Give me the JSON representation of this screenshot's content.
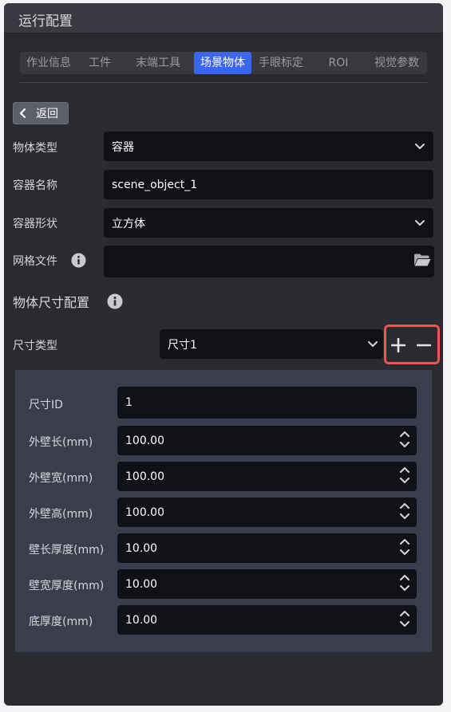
{
  "window": {
    "title": "运行配置"
  },
  "tabs": [
    {
      "label": "作业信息",
      "active": false
    },
    {
      "label": "工件",
      "active": false
    },
    {
      "label": "末端工具",
      "active": false
    },
    {
      "label": "场景物体",
      "active": true
    },
    {
      "label": "手眼标定",
      "active": false
    },
    {
      "label": "ROI",
      "active": false
    },
    {
      "label": "视觉参数",
      "active": false
    }
  ],
  "back_button": {
    "label": "返回"
  },
  "form": {
    "object_type": {
      "label": "物体类型",
      "value": "容器"
    },
    "container_name": {
      "label": "容器名称",
      "value": "scene_object_1"
    },
    "container_shape": {
      "label": "容器形状",
      "value": "立方体"
    },
    "mesh_file": {
      "label": "网格文件",
      "value": ""
    }
  },
  "size_config": {
    "title": "物体尺寸配置",
    "size_type": {
      "label": "尺寸类型",
      "value": "尺寸1"
    }
  },
  "dimensions": {
    "size_id": {
      "label": "尺寸ID",
      "value": "1"
    },
    "outer_length": {
      "label": "外壁长(mm)",
      "value": "100.00"
    },
    "outer_width": {
      "label": "外壁宽(mm)",
      "value": "100.00"
    },
    "outer_height": {
      "label": "外壁高(mm)",
      "value": "100.00"
    },
    "length_wall_thickness": {
      "label": "壁长厚度(mm)",
      "value": "10.00"
    },
    "width_wall_thickness": {
      "label": "壁宽厚度(mm)",
      "value": "10.00"
    },
    "bottom_thickness": {
      "label": "底厚度(mm)",
      "value": "10.00"
    }
  },
  "colors": {
    "accent": "#3b67f0",
    "highlight_border": "#f0534f",
    "panel_bg": "#2a2b30",
    "field_bg": "#101116"
  },
  "icons": [
    "chevron-left-icon",
    "chevron-down-icon",
    "info-icon",
    "folder-icon",
    "plus-icon",
    "minus-icon",
    "spinner-arrows-icon"
  ]
}
